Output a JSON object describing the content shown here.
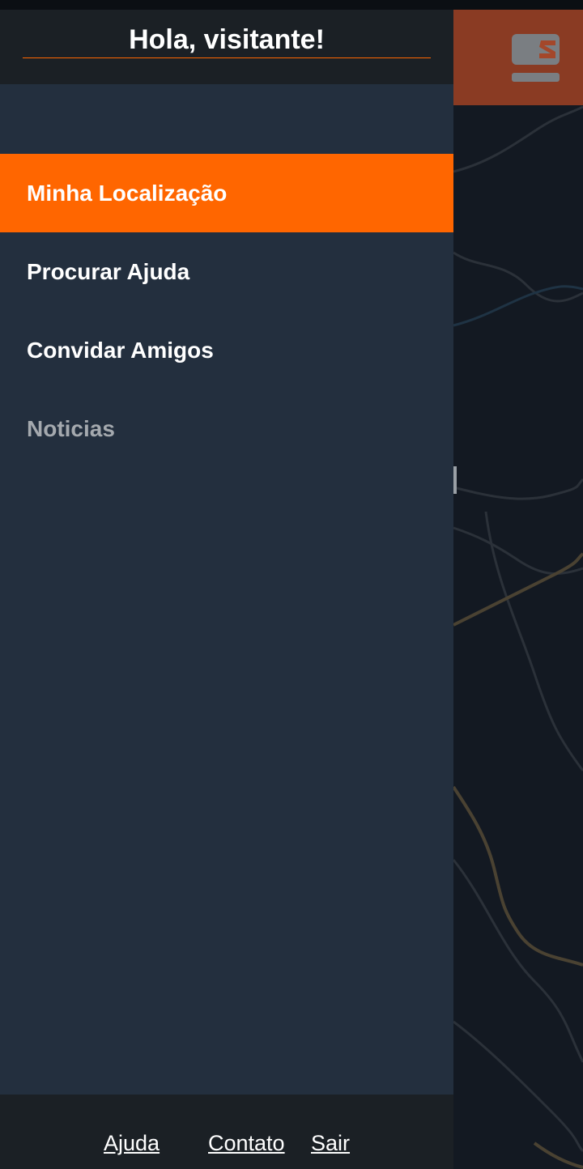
{
  "drawer": {
    "greeting": "Hola, visitante!",
    "menu_items": [
      {
        "label": "Minha Localização",
        "state": "active"
      },
      {
        "label": "Procurar Ajuda",
        "state": "normal"
      },
      {
        "label": "Convidar Amigos",
        "state": "normal"
      },
      {
        "label": "Noticias",
        "state": "disabled"
      }
    ],
    "footer_links": [
      "Ajuda",
      "Contato",
      "Sair"
    ]
  },
  "brand": {
    "logo_icon": "seat-logo-icon"
  },
  "colors": {
    "accent": "#ff6600",
    "drawer_bg": "#232f3e",
    "header_bg": "#1b2025",
    "brand_bar": "#8a3b23",
    "map_bg": "#131922",
    "muted_text": "#a4a9ae"
  }
}
